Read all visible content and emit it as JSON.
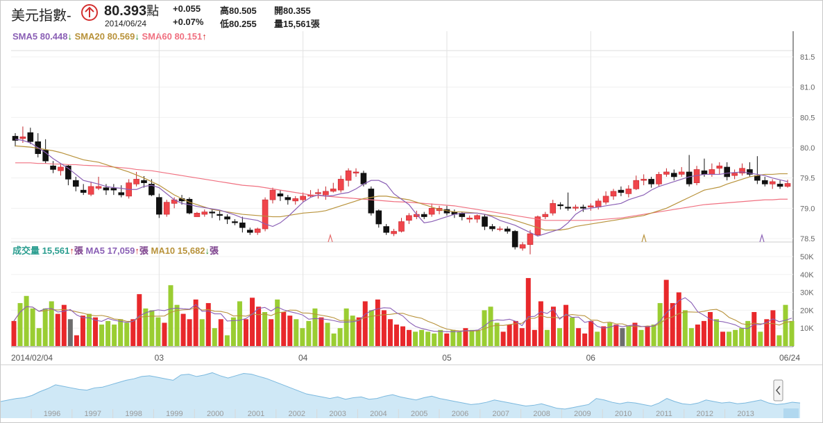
{
  "header": {
    "title": "美元指數-",
    "price": "80.393",
    "price_unit": "點",
    "date": "2014/06/24",
    "change": "+0.055",
    "change_pct": "+0.07%",
    "high": "高80.505",
    "low": "低80.255",
    "open": "開80.355",
    "volume": "量15,561張"
  },
  "indicators": {
    "sma5": "SMA5 80.448",
    "sma20": "SMA20 80.569",
    "sma60": "SMA60 80.151",
    "vol": "成交量 15,561",
    "vol_unit": "張",
    "ma5": "MA5 17,059",
    "ma5_unit": "張",
    "ma10": "MA10 15,682",
    "ma10_unit": "張"
  },
  "colors": {
    "up": "#f0454b",
    "down": "#111111",
    "vol_up": "#e8282b",
    "vol_down": "#9acd32",
    "vol_flat": "#6d6d6d",
    "sma5": "#8a5fb5",
    "sma20": "#b8923a",
    "sma60": "#f07080",
    "vol_text": "#2a9d8f",
    "navigator_fill": "#cfe8f6",
    "navigator_line": "#7ab8de"
  },
  "chart_data": {
    "type": "candlestick",
    "price_axis": {
      "ticks": [
        "81.5",
        "81.0",
        "80.5",
        "80.0",
        "79.5",
        "79.0",
        "78.5"
      ],
      "range": [
        78.5,
        81.5
      ]
    },
    "volume_axis": {
      "ticks": [
        "50K",
        "40K",
        "30K",
        "20K",
        "10K"
      ],
      "range": [
        0,
        50000
      ]
    },
    "x_axis_labels": [
      "2014/02/04",
      "03",
      "04",
      "05",
      "06",
      "06/24"
    ],
    "month_starts_index": [
      0,
      19,
      38,
      57,
      76,
      93
    ],
    "candles": [
      [
        80.19,
        80.12,
        80.24,
        80.02
      ],
      [
        80.15,
        80.18,
        80.35,
        80.08
      ],
      [
        80.25,
        80.1,
        80.33,
        80.06
      ],
      [
        80.1,
        79.9,
        80.24,
        79.84
      ],
      [
        79.96,
        79.78,
        80.14,
        79.74
      ],
      [
        79.7,
        79.64,
        79.78,
        79.58
      ],
      [
        79.62,
        79.68,
        79.74,
        79.54
      ],
      [
        79.7,
        79.48,
        79.72,
        79.38
      ],
      [
        79.46,
        79.36,
        79.52,
        79.28
      ],
      [
        79.3,
        79.26,
        79.4,
        79.22
      ],
      [
        79.23,
        79.36,
        79.44,
        79.2
      ],
      [
        79.33,
        79.36,
        79.52,
        79.3
      ],
      [
        79.34,
        79.3,
        79.4,
        79.22
      ],
      [
        79.33,
        79.3,
        79.4,
        79.22
      ],
      [
        79.26,
        79.22,
        79.38,
        79.18
      ],
      [
        79.2,
        79.42,
        79.48,
        79.16
      ],
      [
        79.4,
        79.48,
        79.6,
        79.36
      ],
      [
        79.46,
        79.42,
        79.53,
        79.34
      ],
      [
        79.4,
        79.22,
        79.48,
        79.2
      ],
      [
        79.18,
        78.9,
        79.24,
        78.84
      ],
      [
        78.9,
        79.1,
        79.14,
        78.86
      ],
      [
        79.08,
        79.14,
        79.18,
        79.0
      ],
      [
        79.16,
        79.12,
        79.22,
        79.06
      ],
      [
        79.15,
        78.92,
        79.18,
        78.9
      ],
      [
        78.86,
        78.92,
        78.94,
        78.86
      ],
      [
        78.9,
        78.94,
        78.98,
        78.86
      ],
      [
        78.94,
        78.92,
        78.98,
        78.84
      ],
      [
        78.9,
        78.88,
        78.96,
        78.8
      ],
      [
        78.86,
        78.82,
        78.9,
        78.74
      ],
      [
        78.78,
        78.76,
        78.82,
        78.72
      ],
      [
        78.76,
        78.68,
        78.86,
        78.6
      ],
      [
        78.64,
        78.6,
        78.68,
        78.56
      ],
      [
        78.6,
        78.66,
        78.68,
        78.56
      ],
      [
        78.66,
        79.14,
        79.18,
        78.62
      ],
      [
        79.14,
        79.3,
        79.34,
        79.08
      ],
      [
        79.24,
        79.2,
        79.3,
        79.12
      ],
      [
        79.18,
        79.14,
        79.22,
        79.06
      ],
      [
        79.12,
        79.16,
        79.2,
        79.06
      ],
      [
        79.14,
        79.2,
        79.26,
        79.1
      ],
      [
        79.2,
        79.22,
        79.3,
        79.18
      ],
      [
        79.24,
        79.26,
        79.32,
        79.16
      ],
      [
        79.22,
        79.28,
        79.36,
        79.14
      ],
      [
        79.28,
        79.32,
        79.42,
        79.26
      ],
      [
        79.3,
        79.48,
        79.54,
        79.26
      ],
      [
        79.46,
        79.62,
        79.66,
        79.36
      ],
      [
        79.58,
        79.6,
        79.66,
        79.52
      ],
      [
        79.58,
        79.4,
        79.62,
        79.36
      ],
      [
        79.32,
        78.92,
        79.36,
        78.88
      ],
      [
        78.96,
        78.74,
        78.98,
        78.68
      ],
      [
        78.7,
        78.6,
        78.74,
        78.56
      ],
      [
        78.58,
        78.62,
        78.66,
        78.54
      ],
      [
        78.62,
        78.78,
        78.84,
        78.6
      ],
      [
        78.8,
        78.88,
        78.92,
        78.74
      ],
      [
        78.86,
        78.9,
        78.96,
        78.82
      ],
      [
        78.9,
        78.86,
        78.94,
        78.82
      ],
      [
        78.9,
        79.0,
        79.08,
        78.86
      ],
      [
        78.96,
        79.0,
        79.04,
        78.9
      ],
      [
        78.98,
        78.92,
        79.04,
        78.88
      ],
      [
        78.94,
        78.9,
        78.98,
        78.84
      ],
      [
        78.92,
        78.86,
        78.94,
        78.8
      ],
      [
        78.82,
        78.84,
        78.88,
        78.76
      ],
      [
        78.82,
        78.88,
        78.9,
        78.76
      ],
      [
        78.86,
        78.7,
        78.9,
        78.64
      ],
      [
        78.7,
        78.66,
        78.74,
        78.62
      ],
      [
        78.66,
        78.66,
        78.7,
        78.62
      ],
      [
        78.66,
        78.62,
        78.7,
        78.58
      ],
      [
        78.62,
        78.36,
        78.64,
        78.32
      ],
      [
        78.34,
        78.4,
        78.44,
        78.3
      ],
      [
        78.4,
        78.58,
        78.64,
        78.24
      ],
      [
        78.56,
        78.86,
        78.88,
        78.54
      ],
      [
        78.86,
        78.9,
        78.94,
        78.82
      ],
      [
        78.92,
        79.08,
        79.14,
        78.88
      ],
      [
        79.06,
        79.04,
        79.1,
        78.98
      ],
      [
        79.02,
        79.0,
        79.26,
        78.96
      ],
      [
        79.0,
        79.02,
        79.06,
        78.96
      ],
      [
        79.02,
        79.0,
        79.06,
        78.94
      ],
      [
        79.02,
        79.04,
        79.08,
        78.96
      ],
      [
        79.02,
        79.12,
        79.16,
        78.98
      ],
      [
        79.1,
        79.2,
        79.28,
        79.06
      ],
      [
        79.2,
        79.28,
        79.32,
        79.14
      ],
      [
        79.3,
        79.26,
        79.36,
        79.2
      ],
      [
        79.24,
        79.32,
        79.38,
        79.18
      ],
      [
        79.32,
        79.46,
        79.54,
        79.3
      ],
      [
        79.46,
        79.48,
        79.56,
        79.38
      ],
      [
        79.48,
        79.4,
        79.52,
        79.34
      ],
      [
        79.4,
        79.56,
        79.6,
        79.36
      ],
      [
        79.56,
        79.6,
        79.66,
        79.52
      ],
      [
        79.58,
        79.52,
        79.64,
        79.46
      ],
      [
        79.56,
        79.6,
        79.68,
        79.52
      ],
      [
        79.6,
        79.4,
        79.88,
        79.36
      ],
      [
        79.42,
        79.64,
        79.7,
        79.38
      ],
      [
        79.62,
        79.56,
        79.82,
        79.52
      ],
      [
        79.56,
        79.64,
        79.74,
        79.52
      ],
      [
        79.66,
        79.7,
        79.76,
        79.56
      ],
      [
        79.68,
        79.52,
        79.76,
        79.46
      ],
      [
        79.54,
        79.58,
        79.64,
        79.48
      ],
      [
        79.58,
        79.66,
        79.74,
        79.54
      ],
      [
        79.64,
        79.56,
        79.76,
        79.52
      ],
      [
        79.54,
        79.46,
        79.86,
        79.4
      ],
      [
        79.46,
        79.4,
        79.52,
        79.36
      ],
      [
        79.4,
        79.44,
        79.48,
        79.32
      ],
      [
        79.4,
        79.36,
        79.46,
        79.32
      ],
      [
        79.36,
        79.41,
        79.47,
        79.34
      ]
    ],
    "sma5": [
      80.14,
      80.12,
      80.08,
      80.0,
      79.92,
      79.82,
      79.74,
      79.66,
      79.56,
      79.46,
      79.4,
      79.36,
      79.34,
      79.33,
      79.31,
      79.31,
      79.36,
      79.38,
      79.34,
      79.24,
      79.14,
      79.08,
      79.06,
      79.03,
      79.01,
      78.99,
      78.97,
      78.93,
      78.89,
      78.84,
      78.8,
      78.74,
      78.7,
      78.76,
      78.86,
      78.98,
      79.1,
      79.18,
      79.22,
      79.2,
      79.21,
      79.24,
      79.26,
      79.32,
      79.4,
      79.46,
      79.46,
      79.4,
      79.24,
      79.06,
      78.9,
      78.76,
      78.78,
      78.82,
      78.86,
      78.9,
      78.92,
      78.92,
      78.92,
      78.9,
      78.86,
      78.8,
      78.76,
      78.72,
      78.66,
      78.6,
      78.54,
      78.58,
      78.66,
      78.76,
      78.9,
      78.98,
      79.0,
      79.02,
      79.04,
      79.06,
      79.08,
      79.14,
      79.18,
      79.22,
      79.3,
      79.36,
      79.4,
      79.44,
      79.48,
      79.52,
      79.54,
      79.56,
      79.56,
      79.58,
      79.59,
      79.6,
      79.58,
      79.56,
      79.54,
      79.5,
      79.47,
      79.44
    ],
    "sma20": [
      80.03,
      80.02,
      80.01,
      79.99,
      79.97,
      79.95,
      79.92,
      79.88,
      79.84,
      79.8,
      79.76,
      79.72,
      79.68,
      79.64,
      79.6,
      79.55,
      79.5,
      79.44,
      79.38,
      79.3,
      79.22,
      79.16,
      79.1,
      79.06,
      79.02,
      78.98,
      78.96,
      78.94,
      78.92,
      78.9,
      78.88,
      78.87,
      78.86,
      78.86,
      78.88,
      78.9,
      78.92,
      78.93,
      78.94,
      78.96,
      79.0,
      79.04,
      79.08,
      79.12,
      79.16,
      79.18,
      79.2,
      79.2,
      79.18,
      79.14,
      79.1,
      79.06,
      79.02,
      78.98,
      78.96,
      78.94,
      78.94,
      78.93,
      78.92,
      78.9,
      78.88,
      78.86,
      78.84,
      78.8,
      78.76,
      78.72,
      78.68,
      78.64,
      78.64,
      78.66,
      78.7,
      78.72,
      78.74,
      78.76,
      78.78,
      78.8,
      78.82,
      78.84,
      78.86,
      78.88,
      78.92,
      78.96,
      79.0,
      79.06,
      79.12,
      79.18,
      79.24,
      79.3,
      79.35,
      79.4,
      79.44,
      79.48,
      79.52,
      79.54,
      79.56,
      79.56,
      79.57,
      79.57
    ],
    "sma60": [
      79.75,
      79.75,
      79.75,
      79.74,
      79.74,
      79.73,
      79.73,
      79.72,
      79.72,
      79.71,
      79.7,
      79.69,
      79.68,
      79.67,
      79.66,
      79.64,
      79.63,
      79.62,
      79.6,
      79.58,
      79.56,
      79.54,
      79.52,
      79.5,
      79.48,
      79.46,
      79.44,
      79.42,
      79.4,
      79.38,
      79.36,
      79.34,
      79.32,
      79.3,
      79.28,
      79.26,
      79.24,
      79.22,
      79.21,
      79.2,
      79.19,
      79.18,
      79.17,
      79.16,
      79.15,
      79.14,
      79.13,
      79.12,
      79.11,
      79.1,
      79.09,
      79.08,
      79.07,
      79.06,
      79.05,
      79.04,
      79.02,
      79.0,
      78.98,
      78.96,
      78.94,
      78.92,
      78.9,
      78.88,
      78.86,
      78.84,
      78.82,
      78.8,
      78.8,
      78.8,
      78.8,
      78.8,
      78.8,
      78.81,
      78.82,
      78.83,
      78.84,
      78.86,
      78.88,
      78.9,
      78.92,
      78.94,
      78.96,
      78.98,
      79.0,
      79.02,
      79.04,
      79.06,
      79.08,
      79.09,
      79.1,
      79.11,
      79.12,
      79.13,
      79.14,
      79.14,
      79.15,
      79.15
    ],
    "volume": [
      14,
      24,
      28,
      21,
      10,
      21,
      25,
      18,
      23,
      15,
      6,
      17,
      18,
      16,
      12,
      14,
      12,
      15,
      13,
      15,
      29,
      21,
      20,
      16,
      13,
      34,
      23,
      18,
      15,
      26,
      15,
      24,
      10,
      15,
      6,
      16,
      25,
      15,
      27,
      22,
      19,
      15,
      26,
      19,
      17,
      15,
      10,
      14,
      21,
      16,
      13,
      7,
      10,
      21,
      17,
      16,
      25,
      20,
      26,
      20,
      15,
      12,
      11,
      9,
      8,
      9,
      8,
      7,
      9,
      7,
      9,
      8,
      10,
      9,
      9,
      20,
      22,
      13,
      8,
      12,
      14,
      10,
      38,
      9,
      25,
      9,
      22,
      10,
      23,
      16,
      10,
      7,
      14,
      8,
      11,
      13,
      12,
      10,
      11,
      13,
      9,
      11,
      12,
      24,
      37,
      24,
      30,
      20,
      10,
      12,
      14,
      19,
      15,
      8,
      8,
      9,
      10,
      14,
      19,
      8,
      15,
      20,
      6,
      23,
      14
    ],
    "volume_dir": [
      1,
      0,
      0,
      0,
      0,
      0,
      0,
      1,
      1,
      2,
      1,
      1,
      0,
      1,
      0,
      0,
      0,
      0,
      0,
      1,
      1,
      0,
      0,
      0,
      1,
      0,
      0,
      1,
      1,
      1,
      0,
      1,
      0,
      1,
      0,
      0,
      0,
      1,
      1,
      1,
      0,
      1,
      0,
      1,
      1,
      0,
      0,
      0,
      0,
      1,
      0,
      0,
      0,
      0,
      0,
      1,
      1,
      0,
      1,
      1,
      1,
      1,
      1,
      1,
      0,
      0,
      0,
      0,
      0,
      1,
      0,
      0,
      1,
      0,
      0,
      0,
      0,
      0,
      1,
      1,
      1,
      1,
      1,
      1,
      1,
      0,
      1,
      0,
      1,
      0,
      1,
      1,
      1,
      0,
      1,
      0,
      1,
      2,
      0,
      1,
      0,
      1,
      0,
      0,
      1,
      1,
      1,
      0,
      0,
      1,
      1,
      1,
      0,
      1,
      0,
      0,
      0,
      0,
      1,
      0,
      1,
      1,
      0,
      0,
      0,
      1
    ]
  },
  "navigator": {
    "years": [
      "1996",
      "1997",
      "1998",
      "1999",
      "2000",
      "2001",
      "2002",
      "2003",
      "2004",
      "2005",
      "2006",
      "2007",
      "2008",
      "2009",
      "2010",
      "2011",
      "2012",
      "2013"
    ],
    "series": [
      82,
      84,
      86,
      87,
      90,
      95,
      99,
      104,
      102,
      100,
      98,
      97,
      100,
      101,
      104,
      107,
      110,
      112,
      115,
      116,
      114,
      112,
      110,
      117,
      118,
      115,
      117,
      120,
      116,
      113,
      116,
      119,
      118,
      115,
      112,
      108,
      104,
      100,
      96,
      92,
      90,
      88,
      86,
      88,
      85,
      87,
      88,
      85,
      86,
      89,
      91,
      88,
      86,
      84,
      87,
      89,
      86,
      84,
      82,
      80,
      78,
      79,
      81,
      84,
      82,
      80,
      78,
      76,
      77,
      79,
      76,
      73,
      72,
      74,
      76,
      78,
      86,
      84,
      81,
      79,
      81,
      80,
      78,
      76,
      80,
      86,
      82,
      79,
      78,
      80,
      84,
      82,
      80,
      81,
      79,
      80,
      82,
      84,
      80,
      78,
      79,
      81,
      80
    ]
  }
}
